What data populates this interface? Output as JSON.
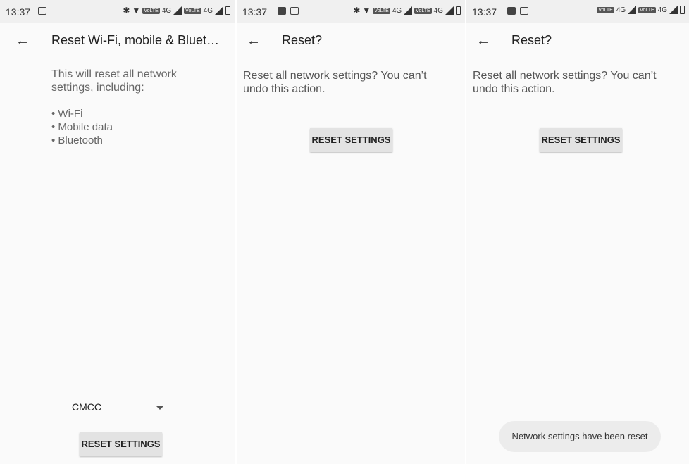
{
  "screens": [
    {
      "status": {
        "time": "13:37"
      },
      "title": "Reset Wi-Fi, mobile & Bluet…",
      "description_line1": "This will reset all network",
      "description_line2": "settings, including:",
      "items": [
        "Wi-Fi",
        "Mobile data",
        "Bluetooth"
      ],
      "carrier": "CMCC",
      "button": "RESET SETTINGS"
    },
    {
      "status": {
        "time": "13:37"
      },
      "title": "Reset?",
      "message_line1": "Reset all network settings? You can’t",
      "message_line2": "undo this action.",
      "button": "RESET SETTINGS"
    },
    {
      "status": {
        "time": "13:37"
      },
      "title": "Reset?",
      "message_line1": "Reset all network settings? You can’t",
      "message_line2": "undo this action.",
      "button": "RESET SETTINGS",
      "toast": "Network settings have been reset"
    }
  ],
  "statusbar_labels": {
    "net": "4G",
    "volte": "VoLTE"
  }
}
